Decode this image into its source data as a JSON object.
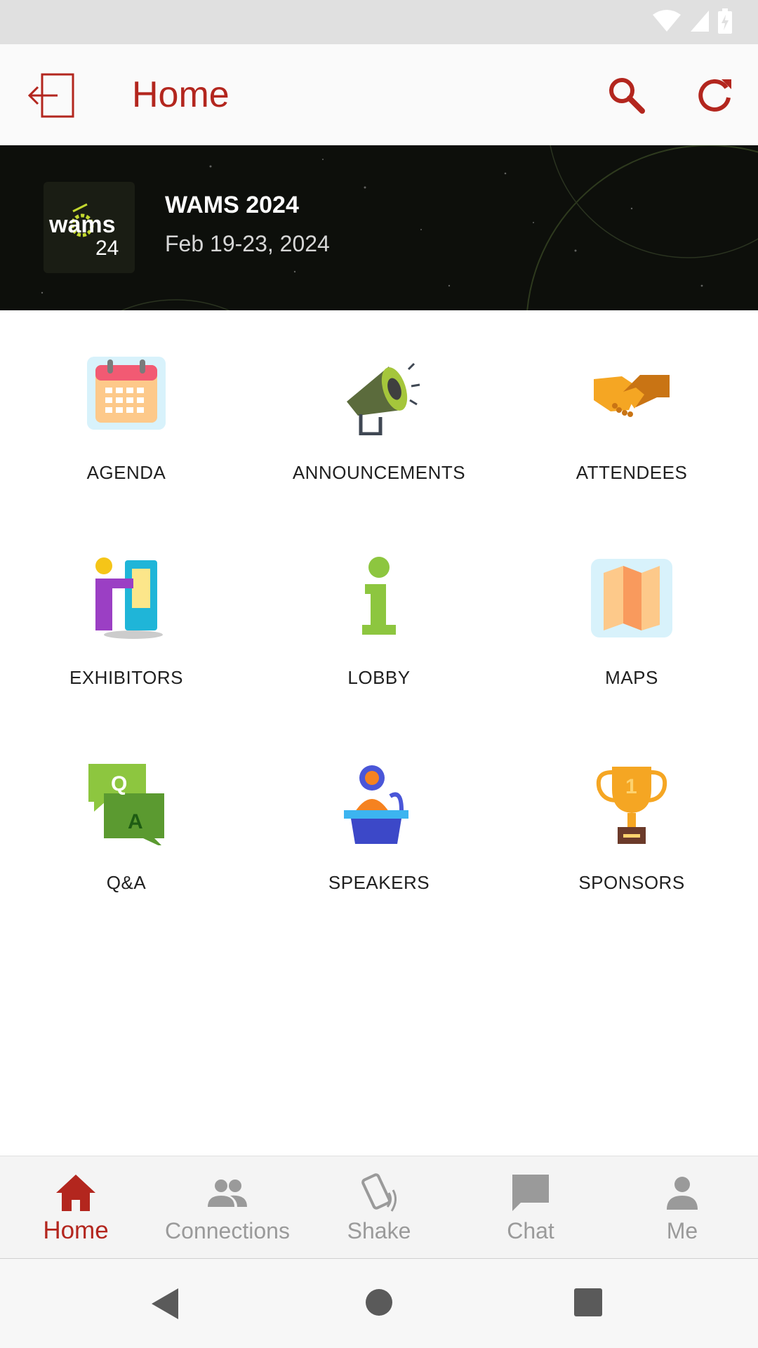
{
  "app_bar": {
    "title": "Home"
  },
  "event": {
    "name": "WAMS 2024",
    "dates": "Feb 19-23, 2024",
    "logo_text_top": "wams",
    "logo_text_bottom": "24"
  },
  "tiles": [
    {
      "label": "AGENDA",
      "icon": "calendar-icon"
    },
    {
      "label": "ANNOUNCEMENTS",
      "icon": "megaphone-icon"
    },
    {
      "label": "ATTENDEES",
      "icon": "handshake-icon"
    },
    {
      "label": "EXHIBITORS",
      "icon": "exhibitor-booth-icon"
    },
    {
      "label": "LOBBY",
      "icon": "info-icon"
    },
    {
      "label": "MAPS",
      "icon": "map-icon"
    },
    {
      "label": "Q&A",
      "icon": "qa-bubbles-icon"
    },
    {
      "label": "SPEAKERS",
      "icon": "speaker-podium-icon"
    },
    {
      "label": "SPONSORS",
      "icon": "trophy-icon"
    }
  ],
  "bottom_nav": [
    {
      "label": "Home",
      "icon": "home-icon",
      "active": true
    },
    {
      "label": "Connections",
      "icon": "people-icon",
      "active": false
    },
    {
      "label": "Shake",
      "icon": "shake-phone-icon",
      "active": false
    },
    {
      "label": "Chat",
      "icon": "chat-icon",
      "active": false
    },
    {
      "label": "Me",
      "icon": "person-icon",
      "active": false
    }
  ],
  "colors": {
    "accent": "#b3261e",
    "inactive": "#9a9a9a",
    "banner_bg": "#0d0f0b",
    "logo_green": "#c3d82f"
  }
}
